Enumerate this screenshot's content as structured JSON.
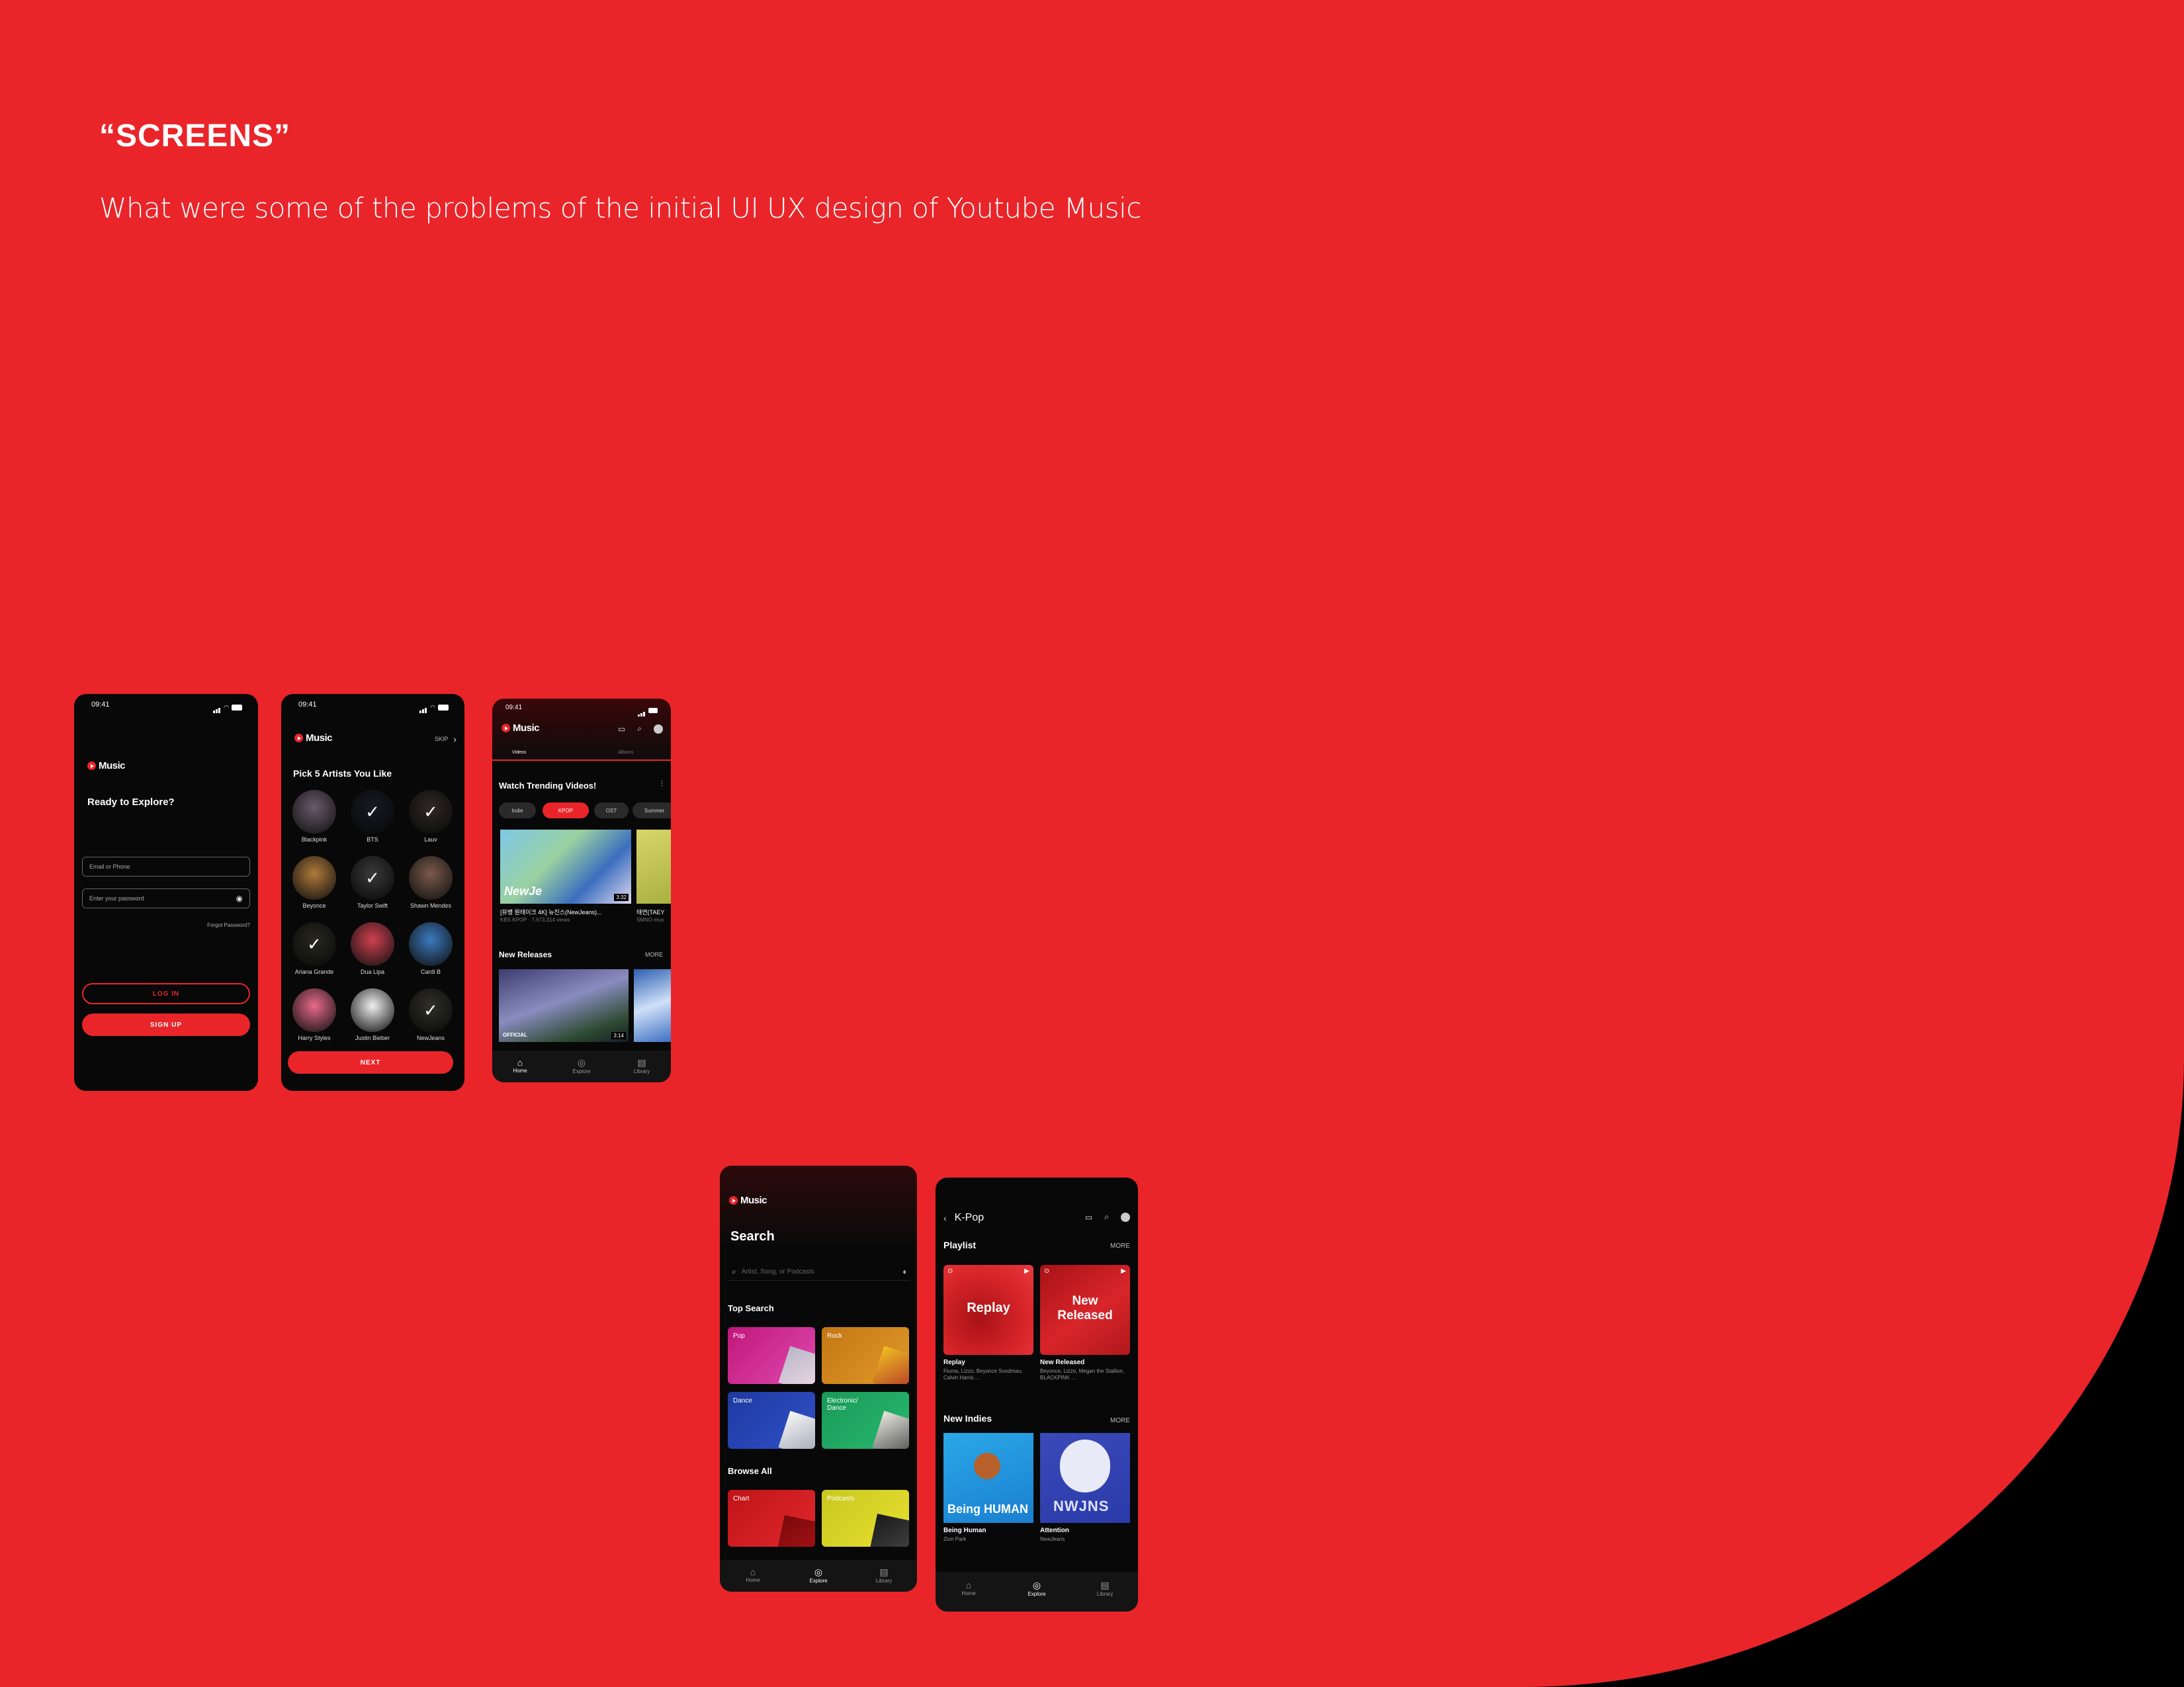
{
  "header": {
    "title": "“SCREENS”",
    "subtitle": "What were some of the problems of the initial UI UX design of Youtube Music"
  },
  "colors": {
    "accent": "#e9252a",
    "background": "#e9252a",
    "screen": "#080808"
  },
  "login": {
    "time": "09:41",
    "brand": "Music",
    "heading": "Ready to Explore?",
    "email_placeholder": "Email or Phone",
    "password_placeholder": "Enter your password",
    "forgot": "Forgot Password?",
    "login_button": "LOG IN",
    "signup_button": "SIGN UP"
  },
  "pick": {
    "time": "09:41",
    "brand": "Music",
    "skip": "SKIP",
    "heading": "Pick 5 Artists You Like",
    "artists": [
      {
        "name": "Blackpink",
        "checked": false
      },
      {
        "name": "BTS",
        "checked": true
      },
      {
        "name": "Lauv",
        "checked": true
      },
      {
        "name": "Beyonce",
        "checked": false
      },
      {
        "name": "Taylor Swift",
        "checked": true
      },
      {
        "name": "Shawn Mendes",
        "checked": false
      },
      {
        "name": "Ariana Grande",
        "checked": true
      },
      {
        "name": "Dua Lipa",
        "checked": false
      },
      {
        "name": "Cardi B",
        "checked": false
      },
      {
        "name": "Harry Styles",
        "checked": false
      },
      {
        "name": "Justin Bieber",
        "checked": false
      },
      {
        "name": "NewJeans",
        "checked": true
      }
    ],
    "next_button": "NEXT"
  },
  "home": {
    "time": "09:41",
    "brand": "Music",
    "tabs": [
      "Videos",
      "Albums"
    ],
    "trending_heading": "Watch Trending Videos!",
    "chips": [
      "Indie",
      "KPOP",
      "OST",
      "Summer"
    ],
    "video_title": "[뮤뱅 원테이크 4K] 뉴진스(NewJeans)...",
    "video_meta": "KBS KPOP · 7,673,314 views",
    "video_duration": "3:32",
    "video2_title": "태연(TAEY",
    "video2_meta": "SMNO mus",
    "new_releases": "New Releases",
    "more": "MORE",
    "release_duration": "3:14",
    "release_badge": "OFFICIAL",
    "nav": [
      "Home",
      "Explore",
      "Library"
    ]
  },
  "search": {
    "brand": "Music",
    "heading": "Search",
    "placeholder": "Artist, Song, or Podcasts",
    "top_search": "Top Search",
    "tiles": [
      "Pop",
      "Rock",
      "Dance",
      "Electronic/ Dance"
    ],
    "browse_all": "Browse All",
    "browse_tiles": [
      "Chart",
      "Podcasts"
    ],
    "nav": [
      "Home",
      "Explore",
      "Library"
    ]
  },
  "kpop": {
    "title": "K-Pop",
    "playlist": "Playlist",
    "more": "MORE",
    "cards": [
      {
        "cover": "Replay",
        "name": "Replay",
        "desc": "Fluma, Lizzo, Beyonce Soodmau, Calvin Harris ..."
      },
      {
        "cover": "New Released",
        "name": "New Released",
        "desc": "Beyonce, Lizzo, Megan the Stallion, BLACKPINK ..."
      }
    ],
    "new_indies": "New Indies",
    "indies": [
      {
        "cover": "Being HUMAN",
        "name": "Being Human",
        "artist": "Zion Park"
      },
      {
        "cover": "NWJNS",
        "name": "Attention",
        "artist": "NewJeans"
      }
    ],
    "nav": [
      "Home",
      "Explore",
      "Library"
    ]
  }
}
